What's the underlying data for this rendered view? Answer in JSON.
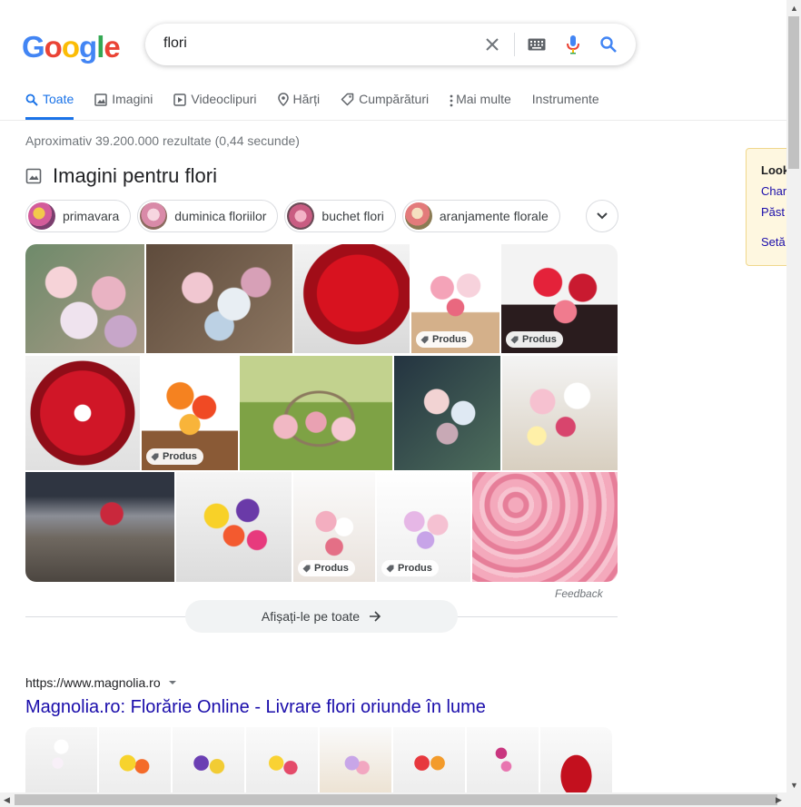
{
  "logo": {
    "letters": [
      "G",
      "o",
      "o",
      "g",
      "l",
      "e"
    ],
    "colors": [
      "#4285f4",
      "#ea4335",
      "#fbbc05",
      "#4285f4",
      "#34a853",
      "#ea4335"
    ]
  },
  "search": {
    "query": "flori"
  },
  "tabs": [
    {
      "label": "Toate",
      "icon": "search-icon"
    },
    {
      "label": "Imagini",
      "icon": "image-icon"
    },
    {
      "label": "Videoclipuri",
      "icon": "play-icon"
    },
    {
      "label": "Hărți",
      "icon": "map-pin-icon"
    },
    {
      "label": "Cumpărături",
      "icon": "tag-icon"
    },
    {
      "label": "Mai multe",
      "icon": "more-vert-icon"
    },
    {
      "label": "Instrumente"
    }
  ],
  "stats": "Aproximativ 39.200.000 rezultate (0,44 secunde)",
  "images": {
    "title": "Imagini pentru flori",
    "chips": [
      "primavara",
      "duminica floriilor",
      "buchet flori",
      "aranjamente florale"
    ],
    "product_badge": "Produs",
    "feedback": "Feedback",
    "show_all": "Afișați-le pe toate"
  },
  "result": {
    "url": "https://www.magnolia.ro",
    "title": "Magnolia.ro: Florărie Online - Livrare flori oriunde în lume"
  },
  "side_panel": {
    "heading": "Look",
    "links": [
      "Char",
      "Păst",
      "Setă"
    ]
  },
  "colors": {
    "link": "#1a0dab",
    "accent": "#1a73e8"
  }
}
